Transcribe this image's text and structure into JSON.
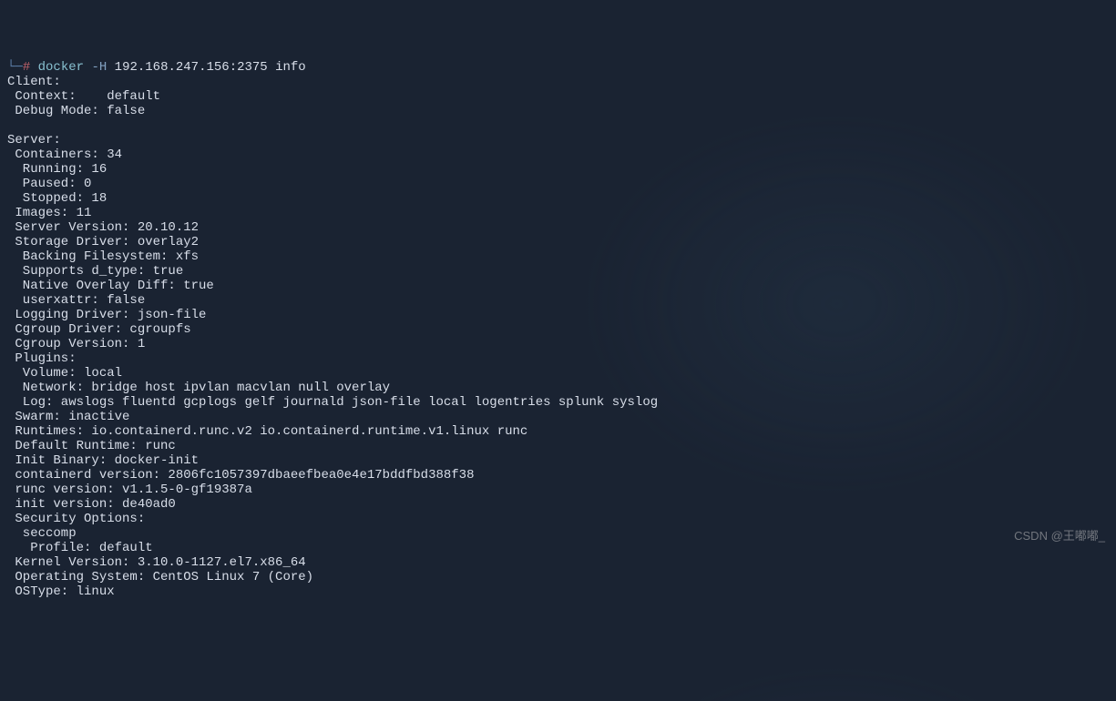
{
  "prompt": {
    "bracket": "└─",
    "hash": "#",
    "command": "docker",
    "flag": "-H",
    "args": "192.168.247.156:2375 info"
  },
  "output": {
    "client_header": "Client:",
    "context": " Context:    default",
    "debug_mode": " Debug Mode: false",
    "blank1": "",
    "server_header": "Server:",
    "containers": " Containers: 34",
    "running": "  Running: 16",
    "paused": "  Paused: 0",
    "stopped": "  Stopped: 18",
    "images": " Images: 11",
    "server_version": " Server Version: 20.10.12",
    "storage_driver": " Storage Driver: overlay2",
    "backing_fs": "  Backing Filesystem: xfs",
    "supports_dtype": "  Supports d_type: true",
    "native_overlay": "  Native Overlay Diff: true",
    "userxattr": "  userxattr: false",
    "logging_driver": " Logging Driver: json-file",
    "cgroup_driver": " Cgroup Driver: cgroupfs",
    "cgroup_version": " Cgroup Version: 1",
    "plugins": " Plugins:",
    "volume": "  Volume: local",
    "network": "  Network: bridge host ipvlan macvlan null overlay",
    "log": "  Log: awslogs fluentd gcplogs gelf journald json-file local logentries splunk syslog",
    "swarm": " Swarm: inactive",
    "runtimes": " Runtimes: io.containerd.runc.v2 io.containerd.runtime.v1.linux runc",
    "default_runtime": " Default Runtime: runc",
    "init_binary": " Init Binary: docker-init",
    "containerd_version": " containerd version: 2806fc1057397dbaeefbea0e4e17bddfbd388f38",
    "runc_version": " runc version: v1.1.5-0-gf19387a",
    "init_version": " init version: de40ad0",
    "security_options": " Security Options:",
    "seccomp": "  seccomp",
    "profile": "   Profile: default",
    "kernel_version": " Kernel Version: 3.10.0-1127.el7.x86_64",
    "operating_system": " Operating System: CentOS Linux 7 (Core)",
    "ostype": " OSType: linux"
  },
  "watermark": "CSDN @王嘟嘟_"
}
